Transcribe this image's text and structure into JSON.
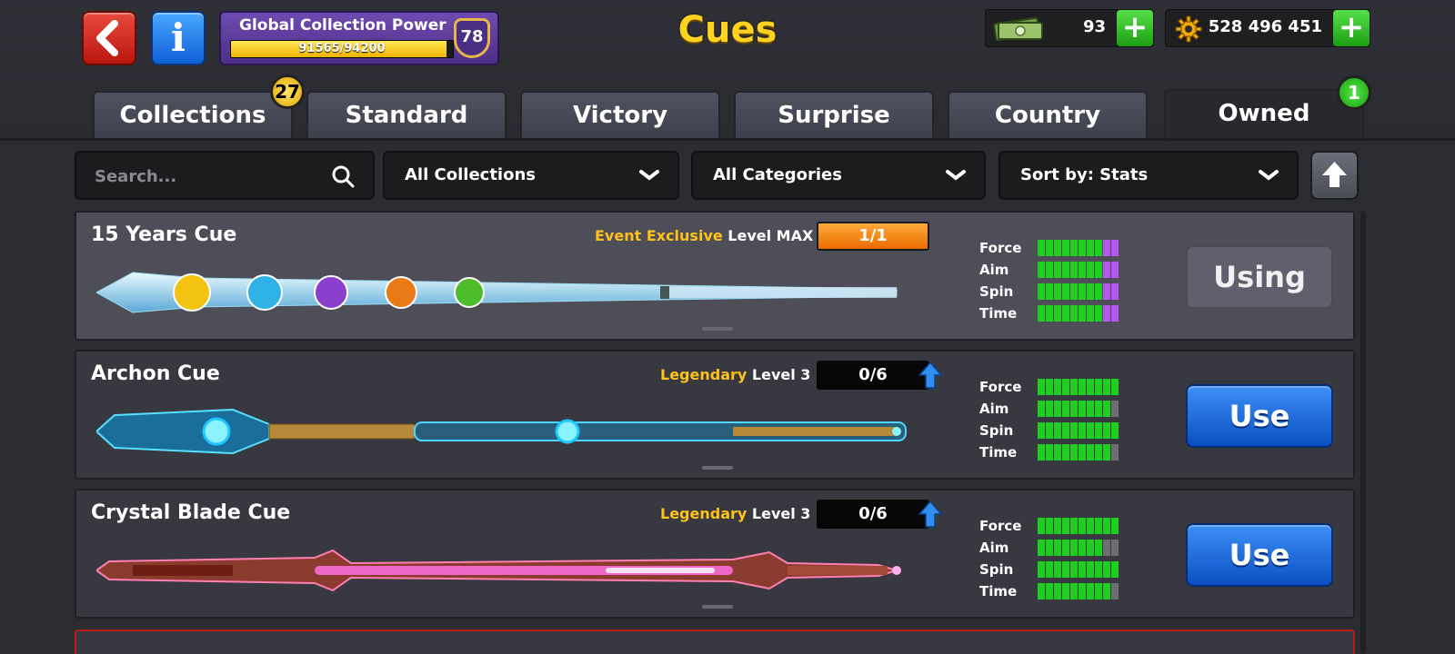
{
  "header": {
    "title": "Cues",
    "collection_power": {
      "label": "Global Collection Power",
      "progress_text": "91565/94200",
      "current": 91565,
      "max": 94200,
      "level": "78"
    },
    "cash": "93",
    "coins": "528 496 451"
  },
  "tabs": [
    {
      "label": "Collections",
      "badge": "27"
    },
    {
      "label": "Standard"
    },
    {
      "label": "Victory"
    },
    {
      "label": "Surprise"
    },
    {
      "label": "Country"
    },
    {
      "label": "Owned",
      "badge": "1",
      "active": true
    }
  ],
  "filters": {
    "search_placeholder": "Search...",
    "collections": "All Collections",
    "categories": "All Categories",
    "sort": "Sort by: Stats"
  },
  "cues": [
    {
      "name": "15 Years Cue",
      "rarity": "Event Exclusive",
      "level": "Level MAX",
      "progress": "1/1",
      "stats": {
        "force_label": "Force",
        "aim_label": "Aim",
        "spin_label": "Spin",
        "time_label": "Time",
        "force": 10,
        "aim": 10,
        "spin": 10,
        "time": 10,
        "max_bar_color": "#b557f0"
      },
      "action": "Using",
      "selected": true
    },
    {
      "name": "Archon Cue",
      "rarity": "Legendary",
      "level": "Level 3",
      "progress": "0/6",
      "stats": {
        "force_label": "Force",
        "aim_label": "Aim",
        "spin_label": "Spin",
        "time_label": "Time",
        "force": 10,
        "aim": 9,
        "spin": 10,
        "time": 9
      },
      "action": "Use"
    },
    {
      "name": "Crystal Blade Cue",
      "rarity": "Legendary",
      "level": "Level 3",
      "progress": "0/6",
      "stats": {
        "force_label": "Force",
        "aim_label": "Aim",
        "spin_label": "Spin",
        "time_label": "Time",
        "force": 10,
        "aim": 8,
        "spin": 10,
        "time": 9
      },
      "action": "Use"
    }
  ],
  "colors": {
    "accent_title": "#ffd21f",
    "rarity": "#ffc21a",
    "stat_filled": "#1fcf1f",
    "stat_empty": "#6e6e72",
    "stat_max": "#b557f0"
  }
}
